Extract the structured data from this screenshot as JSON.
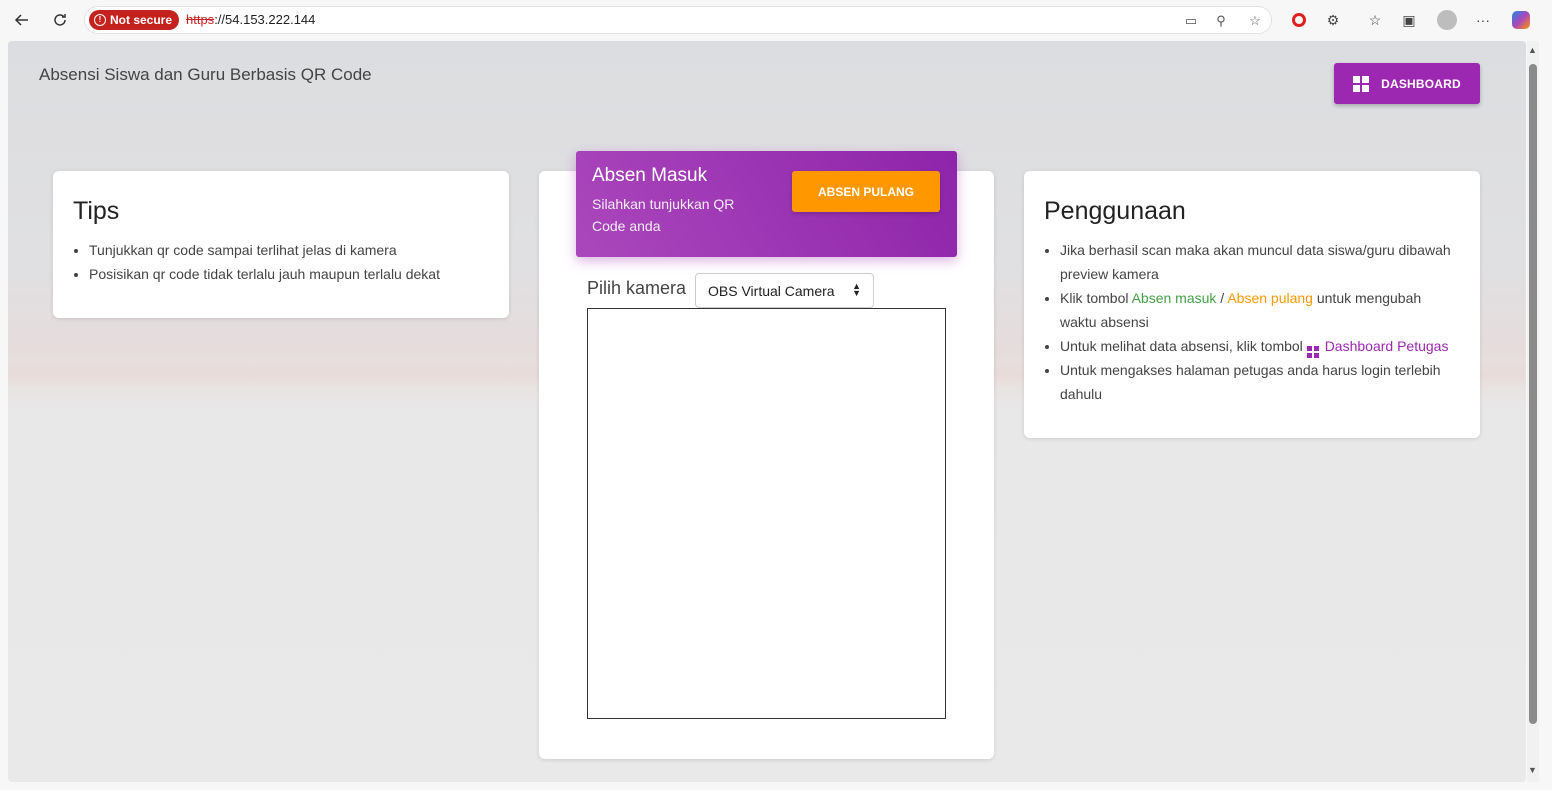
{
  "browser": {
    "security_label": "Not secure",
    "url_scheme": "https",
    "url_rest": "://54.153.222.144",
    "more_label": "···"
  },
  "page": {
    "site_title": "Absensi Siswa dan Guru Berbasis QR Code",
    "dashboard_button": "DASHBOARD"
  },
  "tips": {
    "title": "Tips",
    "items": [
      "Tunjukkan qr code sampai terlihat jelas di kamera",
      "Posisikan qr code tidak terlalu jauh maupun terlalu dekat"
    ]
  },
  "scanner": {
    "header_title": "Absen Masuk",
    "header_subtitle": "Silahkan tunjukkan QR Code anda",
    "switch_button": "ABSEN PULANG",
    "camera_label": "Pilih kamera",
    "camera_selected": "OBS Virtual Camera"
  },
  "guide": {
    "title": "Penggunaan",
    "item1": "Jika berhasil scan maka akan muncul data siswa/guru dibawah preview kamera",
    "item2_pre": "Klik tombol ",
    "item2_masuk": "Absen masuk",
    "item2_sep": " / ",
    "item2_pulang": "Absen pulang",
    "item2_post": " untuk mengubah waktu absensi",
    "item3_pre": "Untuk melihat data absensi, klik tombol ",
    "item3_link": "Dashboard Petugas",
    "item4": "Untuk mengakses halaman petugas anda harus login terlebih dahulu"
  },
  "colors": {
    "accent_purple": "#9c27b0",
    "accent_orange": "#ff9800",
    "accent_green": "#43a047"
  }
}
